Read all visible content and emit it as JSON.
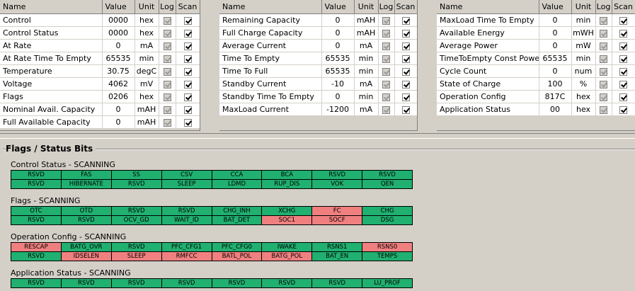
{
  "colors": {
    "bit_off": "#20b070",
    "bit_on": "#f08080",
    "window_bg": "#d4d0c8"
  },
  "columns": {
    "name": "Name",
    "value": "Value",
    "unit": "Unit",
    "log": "Log",
    "scan": "Scan"
  },
  "tables": [
    {
      "rows": [
        {
          "name": "Control",
          "value": "0000",
          "unit": "hex",
          "log": true,
          "scan": true
        },
        {
          "name": "Control Status",
          "value": "0000",
          "unit": "hex",
          "log": true,
          "scan": true
        },
        {
          "name": "At Rate",
          "value": "0",
          "unit": "mA",
          "log": true,
          "scan": true
        },
        {
          "name": "At Rate Time To Empty",
          "value": "65535",
          "unit": "min",
          "log": true,
          "scan": true
        },
        {
          "name": "Temperature",
          "value": "30.75",
          "unit": "degC",
          "log": true,
          "scan": true
        },
        {
          "name": "Voltage",
          "value": "4062",
          "unit": "mV",
          "log": true,
          "scan": true
        },
        {
          "name": "Flags",
          "value": "0206",
          "unit": "hex",
          "log": true,
          "scan": true
        },
        {
          "name": "Nominal Avail. Capacity",
          "value": "0",
          "unit": "mAH",
          "log": true,
          "scan": true
        },
        {
          "name": "Full Available Capacity",
          "value": "0",
          "unit": "mAH",
          "log": true,
          "scan": true
        }
      ]
    },
    {
      "rows": [
        {
          "name": "Remaining Capacity",
          "value": "0",
          "unit": "mAH",
          "log": true,
          "scan": true
        },
        {
          "name": "Full Charge Capacity",
          "value": "0",
          "unit": "mAH",
          "log": true,
          "scan": true
        },
        {
          "name": "Average Current",
          "value": "0",
          "unit": "mA",
          "log": true,
          "scan": true
        },
        {
          "name": "Time To Empty",
          "value": "65535",
          "unit": "min",
          "log": true,
          "scan": true
        },
        {
          "name": "Time To Full",
          "value": "65535",
          "unit": "min",
          "log": true,
          "scan": true
        },
        {
          "name": "Standby Current",
          "value": "-10",
          "unit": "mA",
          "log": true,
          "scan": true
        },
        {
          "name": "Standby Time To Empty",
          "value": "0",
          "unit": "min",
          "log": true,
          "scan": true
        },
        {
          "name": "MaxLoad Current",
          "value": "-1200",
          "unit": "mA",
          "log": true,
          "scan": true
        }
      ]
    },
    {
      "rows": [
        {
          "name": "MaxLoad Time To Empty",
          "value": "0",
          "unit": "min",
          "log": true,
          "scan": true
        },
        {
          "name": "Available Energy",
          "value": "0",
          "unit": "mWH",
          "log": true,
          "scan": true
        },
        {
          "name": "Average Power",
          "value": "0",
          "unit": "mW",
          "log": true,
          "scan": true
        },
        {
          "name": "TimeToEmpty Const Power",
          "value": "65535",
          "unit": "min",
          "log": true,
          "scan": true
        },
        {
          "name": "Cycle Count",
          "value": "0",
          "unit": "num",
          "log": true,
          "scan": true
        },
        {
          "name": "State of Charge",
          "value": "100",
          "unit": "%",
          "log": true,
          "scan": true
        },
        {
          "name": "Operation Config",
          "value": "817C",
          "unit": "hex",
          "log": true,
          "scan": true
        },
        {
          "name": "Application Status",
          "value": "00",
          "unit": "hex",
          "log": true,
          "scan": true
        }
      ]
    }
  ],
  "flags_title": "Flags / Status Bits",
  "bit_groups": [
    {
      "label": "Control Status - SCANNING",
      "rows": [
        [
          {
            "t": "RSVD",
            "on": false
          },
          {
            "t": "FAS",
            "on": false
          },
          {
            "t": "SS",
            "on": false
          },
          {
            "t": "CSV",
            "on": false
          },
          {
            "t": "CCA",
            "on": false
          },
          {
            "t": "BCA",
            "on": false
          },
          {
            "t": "RSVD",
            "on": false
          },
          {
            "t": "RSVD",
            "on": false
          }
        ],
        [
          {
            "t": "RSVD",
            "on": false
          },
          {
            "t": "HIBERNATE",
            "on": false
          },
          {
            "t": "RSVD",
            "on": false
          },
          {
            "t": "SLEEP",
            "on": false
          },
          {
            "t": "LDMD",
            "on": false
          },
          {
            "t": "RUP_DIS",
            "on": false
          },
          {
            "t": "VOK",
            "on": false
          },
          {
            "t": "QEN",
            "on": false
          }
        ]
      ]
    },
    {
      "label": "Flags - SCANNING",
      "rows": [
        [
          {
            "t": "OTC",
            "on": false
          },
          {
            "t": "OTD",
            "on": false
          },
          {
            "t": "RSVD",
            "on": false
          },
          {
            "t": "RSVD",
            "on": false
          },
          {
            "t": "CHG_INH",
            "on": false
          },
          {
            "t": "XCHG",
            "on": false
          },
          {
            "t": "FC",
            "on": true
          },
          {
            "t": "CHG",
            "on": false
          }
        ],
        [
          {
            "t": "RSVD",
            "on": false
          },
          {
            "t": "RSVD",
            "on": false
          },
          {
            "t": "OCV_GD",
            "on": false
          },
          {
            "t": "WAIT_ID",
            "on": false
          },
          {
            "t": "BAT_DET",
            "on": false
          },
          {
            "t": "SOC1",
            "on": true
          },
          {
            "t": "SOCF",
            "on": true
          },
          {
            "t": "DSG",
            "on": false
          }
        ]
      ]
    },
    {
      "label": "Operation Config - SCANNING",
      "rows": [
        [
          {
            "t": "RESCAP",
            "on": true
          },
          {
            "t": "BATG_OVR",
            "on": false
          },
          {
            "t": "RSVD",
            "on": false
          },
          {
            "t": "PFC_CFG1",
            "on": false
          },
          {
            "t": "PFC_CFG0",
            "on": false
          },
          {
            "t": "IWAKE",
            "on": false
          },
          {
            "t": "RSNS1",
            "on": false
          },
          {
            "t": "RSNS0",
            "on": true
          }
        ],
        [
          {
            "t": "RSVD",
            "on": false
          },
          {
            "t": "IDSELEN",
            "on": true
          },
          {
            "t": "SLEEP",
            "on": true
          },
          {
            "t": "RMFCC",
            "on": true
          },
          {
            "t": "BATL_POL",
            "on": true
          },
          {
            "t": "BATG_POL",
            "on": true
          },
          {
            "t": "BAT_EN",
            "on": false
          },
          {
            "t": "TEMPS",
            "on": false
          }
        ]
      ]
    },
    {
      "label": "Application Status - SCANNING",
      "rows": [
        [
          {
            "t": "RSVD",
            "on": false
          },
          {
            "t": "RSVD",
            "on": false
          },
          {
            "t": "RSVD",
            "on": false
          },
          {
            "t": "RSVD",
            "on": false
          },
          {
            "t": "RSVD",
            "on": false
          },
          {
            "t": "RSVD",
            "on": false
          },
          {
            "t": "RSVD",
            "on": false
          },
          {
            "t": "LU_PROF",
            "on": false
          }
        ]
      ]
    }
  ]
}
